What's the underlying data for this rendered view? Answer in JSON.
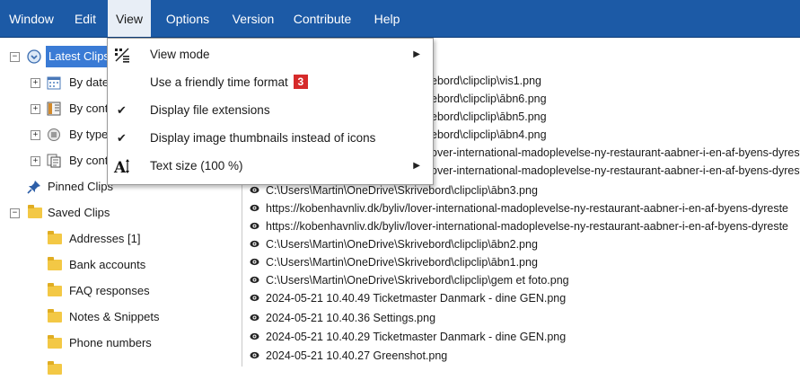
{
  "menubar": {
    "items": [
      "Window",
      "Edit",
      "View",
      "Options",
      "Version",
      "Contribute",
      "Help"
    ],
    "active": "View"
  },
  "tree": {
    "latest": "Latest Clips",
    "by_date": "By date",
    "by_cont1": "By cont",
    "by_type": "By type",
    "by_cont2": "By cont",
    "pinned": "Pinned Clips",
    "saved": "Saved Clips",
    "folders": [
      "Addresses [1]",
      "Bank accounts",
      "FAQ responses",
      "Notes & Snippets",
      "Phone numbers"
    ]
  },
  "list": {
    "items": [
      "ebord\\clipclip\\vis1.png",
      "ebord\\clipclip\\ābn6.png",
      "ebord\\clipclip\\ābn5.png",
      "ebord\\clipclip\\ābn4.png",
      "over-international-madoplevelse-ny-restaurant-aabner-i-en-af-byens-dyreste",
      "over-international-madoplevelse-ny-restaurant-aabner-i-en-af-byens-dyreste",
      "C:\\Users\\Martin\\OneDrive\\Skrivebord\\clipclip\\ābn3.png",
      "https://kobenhavnliv.dk/byliv/lover-international-madoplevelse-ny-restaurant-aabner-i-en-af-byens-dyreste",
      "https://kobenhavnliv.dk/byliv/lover-international-madoplevelse-ny-restaurant-aabner-i-en-af-byens-dyreste",
      "C:\\Users\\Martin\\OneDrive\\Skrivebord\\clipclip\\ābn2.png",
      "C:\\Users\\Martin\\OneDrive\\Skrivebord\\clipclip\\ābn1.png",
      "C:\\Users\\Martin\\OneDrive\\Skrivebord\\clipclip\\gem et foto.png",
      "2024-05-21 10.40.49 Ticketmaster Danmark - dine GEN.png",
      "2024-05-21 10.40.36 Settings.png",
      "2024-05-21 10.40.29 Ticketmaster Danmark - dine GEN.png",
      "2024-05-21 10.40.27 Greenshot.png"
    ]
  },
  "view_menu": {
    "view_mode": "View mode",
    "friendly_time": "Use a friendly time format",
    "badge": "3",
    "file_ext": "Display file extensions",
    "thumbnails": "Display image thumbnails instead of icons",
    "text_size": "Text size (100 %)",
    "check_glyph": "✔",
    "arrow_glyph": "▶"
  },
  "colors": {
    "menubar": "#1c5aa6",
    "selection": "#3a7bd5",
    "badge": "#d62a2a"
  }
}
